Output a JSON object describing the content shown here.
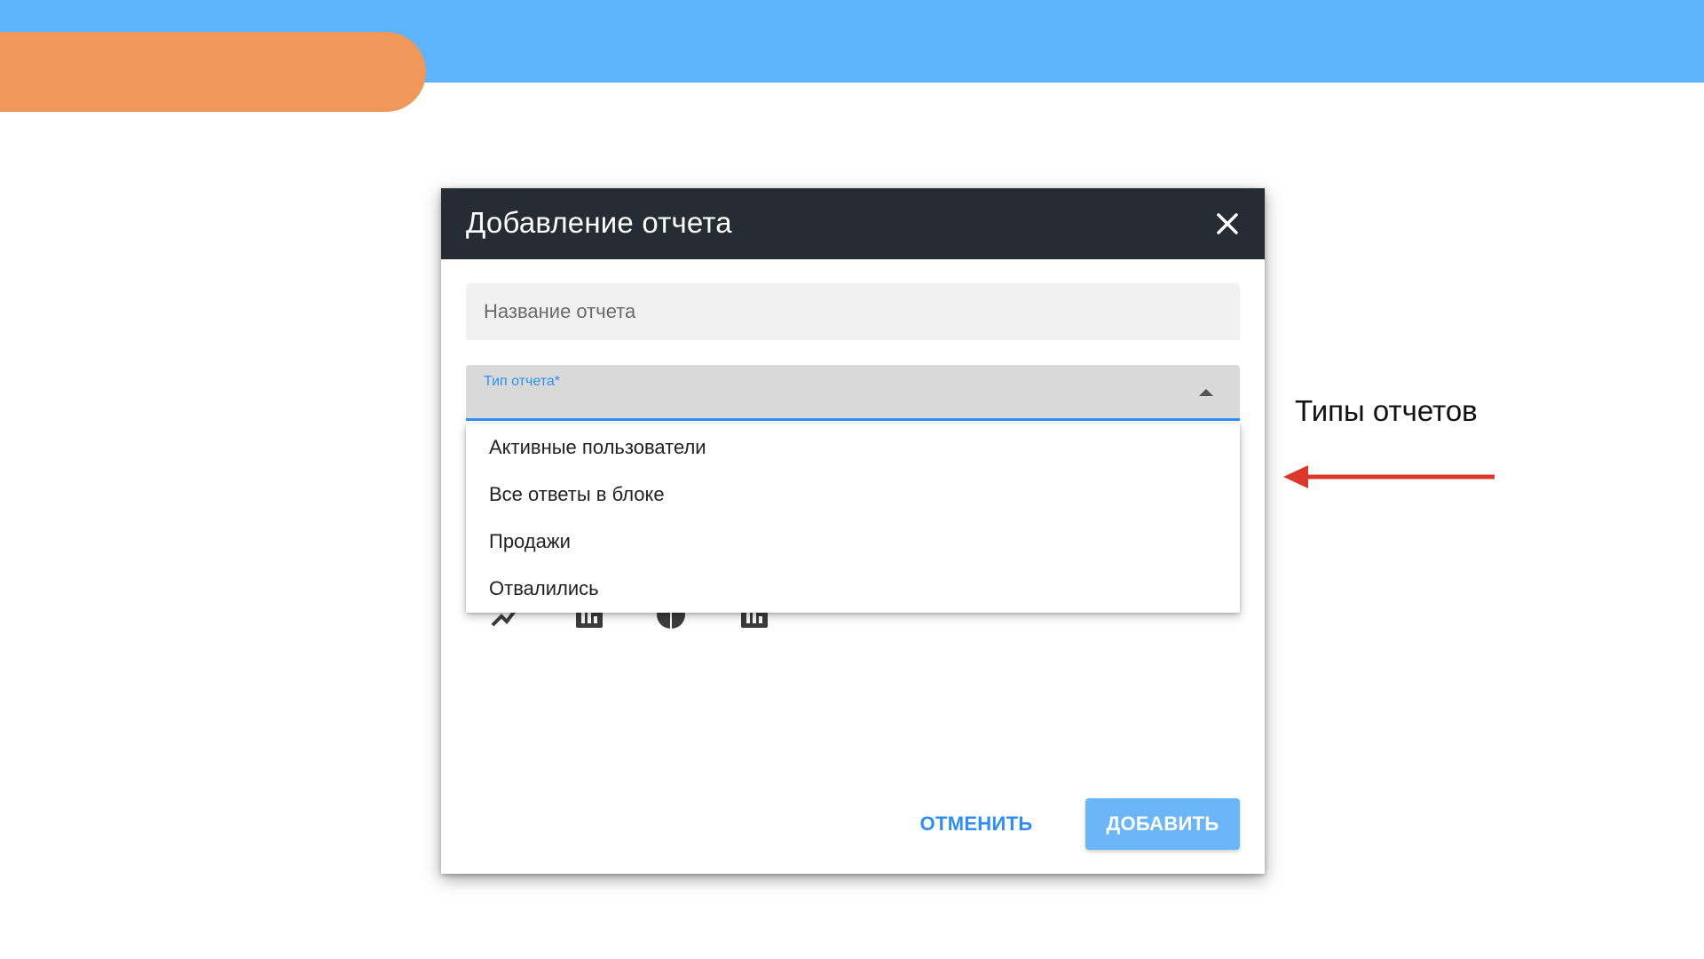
{
  "dialog": {
    "title": "Добавление отчета",
    "name_field": {
      "placeholder": "Название отчета",
      "value": ""
    },
    "type_select": {
      "label": "Тип отчета*",
      "value": ""
    },
    "dropdown_options": [
      "Активные пользователи",
      "Все ответы в блоке",
      "Продажи",
      "Отвалились"
    ],
    "chart_type_icons": [
      "line-chart-icon",
      "bar-chart-icon",
      "pie-chart-icon",
      "bar-chart-icon"
    ],
    "cancel_label": "ОТМЕНИТЬ",
    "add_label": "ДОБАВИТЬ"
  },
  "annotation": {
    "text": "Типы отчетов"
  },
  "colors": {
    "top_band": "#5fb3fb",
    "orange_pill": "#f0985a",
    "dialog_header": "#252c33",
    "accent": "#2f8ef5",
    "add_button": "#6bb6f7",
    "arrow": "#d9382a"
  }
}
